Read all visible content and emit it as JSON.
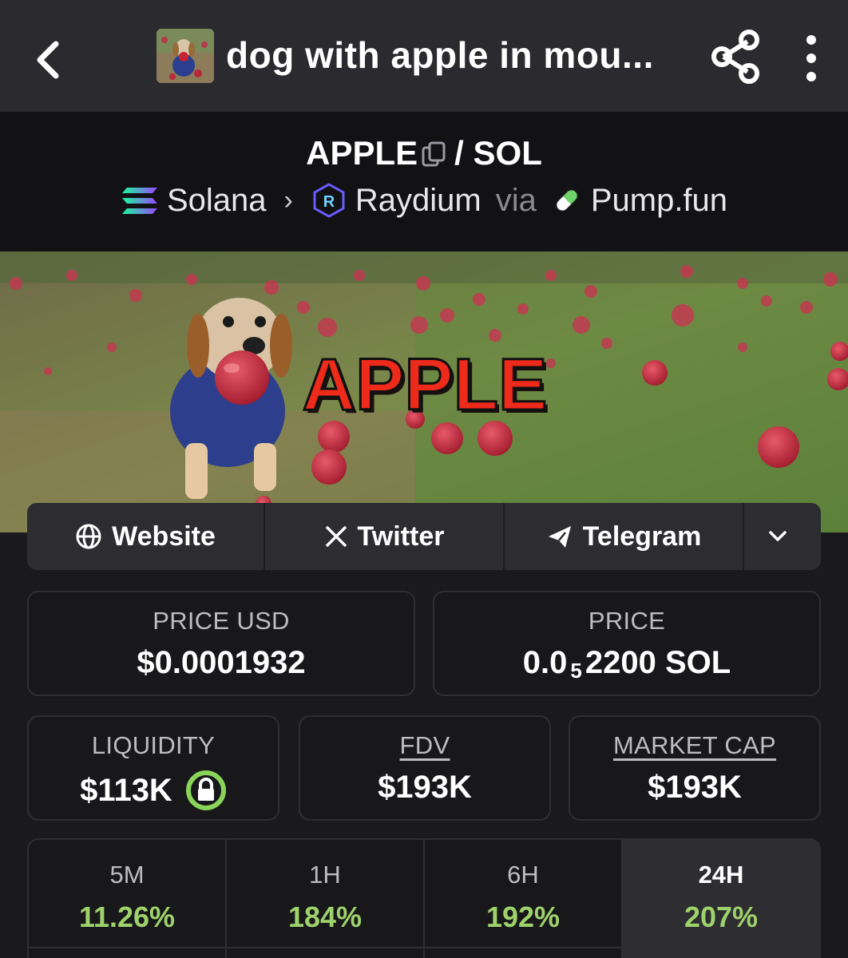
{
  "header": {
    "title": "dog with apple in mou...",
    "icons": [
      "back-arrow-icon",
      "share-icon",
      "more-vertical-icon"
    ]
  },
  "pair": {
    "base": "APPLE",
    "separator": "/ SOL",
    "chain": "Solana",
    "dex": "Raydium",
    "via": "via",
    "launchpad": "Pump.fun"
  },
  "banner": {
    "text": "APPLE"
  },
  "links": {
    "website": "Website",
    "twitter": "Twitter",
    "telegram": "Telegram"
  },
  "stats": {
    "price_usd_label": "PRICE USD",
    "price_usd": "$0.0001932",
    "price_label": "PRICE",
    "price_sol_prefix": "0.0",
    "price_sol_zeros": "5",
    "price_sol_suffix": "2200 SOL",
    "liquidity_label": "LIQUIDITY",
    "liquidity": "$113K",
    "fdv_label": "FDV",
    "fdv": "$193K",
    "mcap_label": "MARKET CAP",
    "mcap": "$193K"
  },
  "timeframes": [
    {
      "label": "5M",
      "change": "11.26%"
    },
    {
      "label": "1H",
      "change": "184%"
    },
    {
      "label": "6H",
      "change": "192%"
    },
    {
      "label": "24H",
      "change": "207%"
    }
  ],
  "colors": {
    "positive": "#9ed26b",
    "lock": "#8bd45a",
    "card_border": "#2e2e33",
    "background": "#1a1a1e"
  }
}
